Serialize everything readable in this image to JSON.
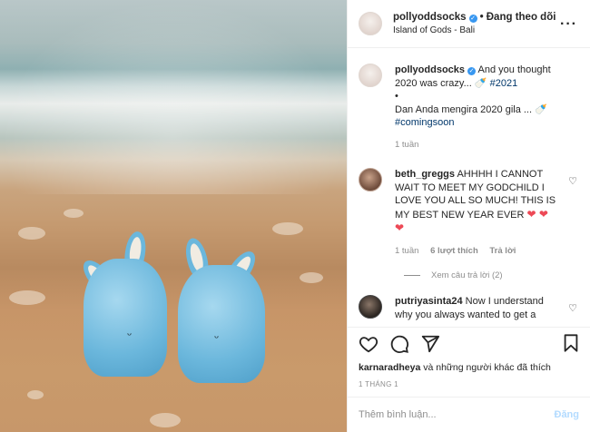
{
  "photo": {
    "alt_icon": "knitted-bunny-booties-photo"
  },
  "header": {
    "username": "pollyoddsocks",
    "separator": "•",
    "follow_label": "Đang theo dõi",
    "location": "Island of Gods - Bali",
    "more_icon": "more-dots-icon"
  },
  "caption": {
    "username": "pollyoddsocks",
    "line1": "And you thought 2020 was crazy... 🍼",
    "tag1": "#2021",
    "bullet": "•",
    "line2": "Dan Anda mengira 2020 gila ... 🍼",
    "tag2": "#comingsoon",
    "time": "1 tuần"
  },
  "comments": [
    {
      "username": "beth_greggs",
      "text": "AHHHH I CANNOT WAIT TO MEET MY GODCHILD I LOVE YOU ALL SO MUCH! THIS IS MY BEST NEW YEAR EVER",
      "emoji": "❤ ❤ ❤",
      "time": "1 tuần",
      "likes": "6 lượt thích",
      "reply": "Trả lời",
      "view_replies": "Xem câu trả lời (2)"
    },
    {
      "username": "putriyasinta24",
      "text": "Now I understand why you always wanted to get a"
    }
  ],
  "actions": {
    "liked_by": "karnaradheya",
    "liked_rest": "và những người khác đã thích",
    "date": "1 THÁNG 1"
  },
  "composer": {
    "placeholder": "Thêm bình luận...",
    "post_label": "Đăng"
  }
}
